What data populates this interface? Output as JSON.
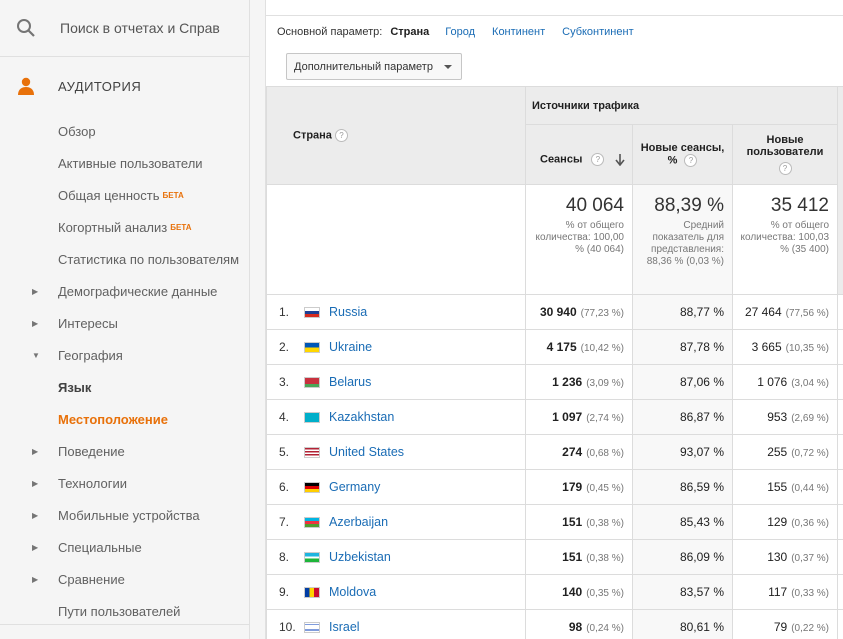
{
  "sidebar": {
    "search_placeholder": "Поиск в отчетах и Справк",
    "section_title": "АУДИТОРИЯ",
    "items": [
      {
        "label": "Обзор",
        "arrow": ""
      },
      {
        "label": "Активные пользователи",
        "arrow": ""
      },
      {
        "label": "Общая ценность",
        "arrow": "",
        "badge": "БЕТА"
      },
      {
        "label": "Когортный анализ",
        "arrow": "",
        "badge": "БЕТА"
      },
      {
        "label": "Статистика по пользователям",
        "arrow": ""
      },
      {
        "label": "Демографические данные",
        "arrow": "▶"
      },
      {
        "label": "Интересы",
        "arrow": "▶"
      },
      {
        "label": "География",
        "arrow": "▼"
      },
      {
        "label": "Язык",
        "arrow": ""
      },
      {
        "label": "Местоположение",
        "arrow": ""
      },
      {
        "label": "Поведение",
        "arrow": "▶"
      },
      {
        "label": "Технологии",
        "arrow": "▶"
      },
      {
        "label": "Мобильные устройства",
        "arrow": "▶"
      },
      {
        "label": "Специальные",
        "arrow": "▶"
      },
      {
        "label": "Сравнение",
        "arrow": "▶"
      },
      {
        "label": "Пути пользователей",
        "arrow": ""
      }
    ]
  },
  "dimensions": {
    "label": "Основной параметр:",
    "selected": "Страна",
    "links": [
      "Город",
      "Континент",
      "Субконтинент"
    ]
  },
  "secondary_button": "Дополнительный параметр",
  "table": {
    "col_country": "Страна",
    "group": "Источники трафика",
    "col_sessions": "Сеансы",
    "col_new_sessions": "Новые сеансы, %",
    "col_new_users": "Новые пользователи",
    "summary": {
      "sessions_big": "40 064",
      "sessions_small": "% от общего количества: 100,00 % (40 064)",
      "new_sessions_big": "88,39 %",
      "new_sessions_small": "Средний показатель для представления: 88,36 % (0,03 %)",
      "new_users_big": "35 412",
      "new_users_small": "% от общего количества: 100,03 % (35 400)"
    },
    "rows": [
      {
        "n": "1.",
        "country": "Russia",
        "sessions": "30 940",
        "sessions_pct": "(77,23 %)",
        "new_sessions": "88,77 %",
        "new_users": "27 464",
        "new_users_pct": "(77,56 %)"
      },
      {
        "n": "2.",
        "country": "Ukraine",
        "sessions": "4 175",
        "sessions_pct": "(10,42 %)",
        "new_sessions": "87,78 %",
        "new_users": "3 665",
        "new_users_pct": "(10,35 %)"
      },
      {
        "n": "3.",
        "country": "Belarus",
        "sessions": "1 236",
        "sessions_pct": "(3,09 %)",
        "new_sessions": "87,06 %",
        "new_users": "1 076",
        "new_users_pct": "(3,04 %)"
      },
      {
        "n": "4.",
        "country": "Kazakhstan",
        "sessions": "1 097",
        "sessions_pct": "(2,74 %)",
        "new_sessions": "86,87 %",
        "new_users": "953",
        "new_users_pct": "(2,69 %)"
      },
      {
        "n": "5.",
        "country": "United States",
        "sessions": "274",
        "sessions_pct": "(0,68 %)",
        "new_sessions": "93,07 %",
        "new_users": "255",
        "new_users_pct": "(0,72 %)"
      },
      {
        "n": "6.",
        "country": "Germany",
        "sessions": "179",
        "sessions_pct": "(0,45 %)",
        "new_sessions": "86,59 %",
        "new_users": "155",
        "new_users_pct": "(0,44 %)"
      },
      {
        "n": "7.",
        "country": "Azerbaijan",
        "sessions": "151",
        "sessions_pct": "(0,38 %)",
        "new_sessions": "85,43 %",
        "new_users": "129",
        "new_users_pct": "(0,36 %)"
      },
      {
        "n": "8.",
        "country": "Uzbekistan",
        "sessions": "151",
        "sessions_pct": "(0,38 %)",
        "new_sessions": "86,09 %",
        "new_users": "130",
        "new_users_pct": "(0,37 %)"
      },
      {
        "n": "9.",
        "country": "Moldova",
        "sessions": "140",
        "sessions_pct": "(0,35 %)",
        "new_sessions": "83,57 %",
        "new_users": "117",
        "new_users_pct": "(0,33 %)"
      },
      {
        "n": "10.",
        "country": "Israel",
        "sessions": "98",
        "sessions_pct": "(0,24 %)",
        "new_sessions": "80,61 %",
        "new_users": "79",
        "new_users_pct": "(0,22 %)"
      }
    ]
  },
  "colors": {
    "accent": "#e8710a",
    "link": "#1a6cb5"
  },
  "icons": {
    "search": "search-icon",
    "audience": "person-icon",
    "help": "help-icon",
    "sort": "sort-down-icon"
  }
}
